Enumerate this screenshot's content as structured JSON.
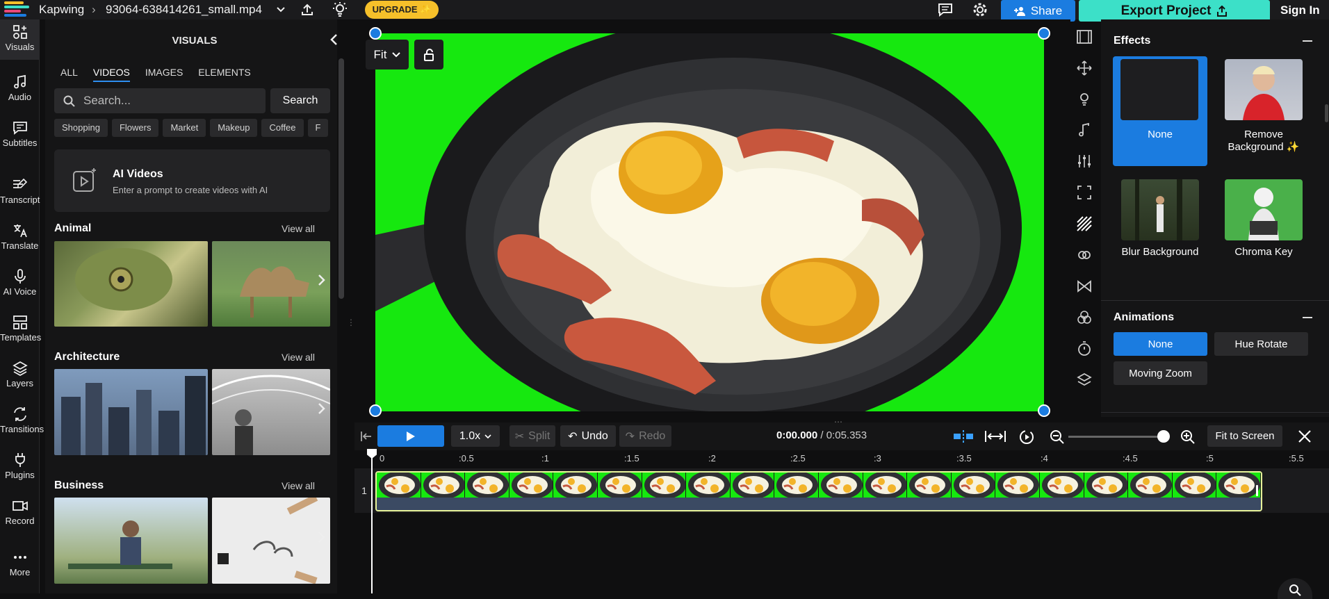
{
  "topbar": {
    "brand": "Kapwing",
    "file_name": "93064-638414261_small.mp4",
    "upgrade_label": "UPGRADE ✨",
    "share_label": "Share",
    "export_label": "Export Project",
    "signin_label": "Sign In"
  },
  "leftnav": {
    "items": [
      {
        "label": "Visuals",
        "icon": "visuals-icon"
      },
      {
        "label": "Audio",
        "icon": "music-note-icon"
      },
      {
        "label": "Subtitles",
        "icon": "subtitles-icon"
      },
      {
        "label": "Transcript",
        "icon": "transcript-icon"
      },
      {
        "label": "Translate",
        "icon": "translate-icon"
      },
      {
        "label": "AI Voice",
        "icon": "microphone-icon"
      },
      {
        "label": "Templates",
        "icon": "templates-icon"
      },
      {
        "label": "Layers",
        "icon": "layers-icon"
      },
      {
        "label": "Transitions",
        "icon": "transitions-icon"
      },
      {
        "label": "Plugins",
        "icon": "plug-icon"
      },
      {
        "label": "Record",
        "icon": "camera-icon"
      },
      {
        "label": "More",
        "icon": "ellipsis-icon"
      }
    ]
  },
  "visuals_panel": {
    "title": "VISUALS",
    "tabs": [
      "ALL",
      "VIDEOS",
      "IMAGES",
      "ELEMENTS"
    ],
    "active_tab": "VIDEOS",
    "search_placeholder": "Search...",
    "search_button": "Search",
    "chips": [
      "Shopping",
      "Flowers",
      "Market",
      "Makeup",
      "Coffee",
      "F"
    ],
    "ai_card": {
      "title": "AI Videos",
      "subtitle": "Enter a prompt to create videos with AI"
    },
    "sections": [
      {
        "title": "Animal",
        "view_all": "View all"
      },
      {
        "title": "Architecture",
        "view_all": "View all"
      },
      {
        "title": "Business",
        "view_all": "View all"
      }
    ]
  },
  "canvas": {
    "fit_label": "Fit"
  },
  "properties": {
    "effects_title": "Effects",
    "effects": [
      {
        "label": "None",
        "selected": true
      },
      {
        "label": "Remove Background ✨",
        "selected": false
      },
      {
        "label": "Blur Background",
        "selected": false
      },
      {
        "label": "Chroma Key",
        "selected": false
      }
    ],
    "animations_title": "Animations",
    "animations": [
      {
        "label": "None",
        "selected": true
      },
      {
        "label": "Hue Rotate",
        "selected": false
      },
      {
        "label": "Moving Zoom",
        "selected": false
      }
    ]
  },
  "timeline": {
    "speed": "1.0x",
    "split_label": "Split",
    "undo_label": "Undo",
    "redo_label": "Redo",
    "current_time": "0:00.000",
    "total_time": "/ 0:05.353",
    "fit_to_screen": "Fit to Screen",
    "ruler_labels": [
      "0",
      ":0.5",
      ":1",
      ":1.5",
      ":2",
      ":2.5",
      ":3",
      ":3.5",
      ":4",
      ":4.5",
      ":5",
      ":5.5"
    ],
    "track_number": "1"
  },
  "colors": {
    "accent_blue": "#1b7ce0",
    "export_teal": "#3ce0c8",
    "upgrade_yellow": "#f6c02a",
    "green_screen": "#16e80f",
    "clip_border": "#e8f39a"
  }
}
